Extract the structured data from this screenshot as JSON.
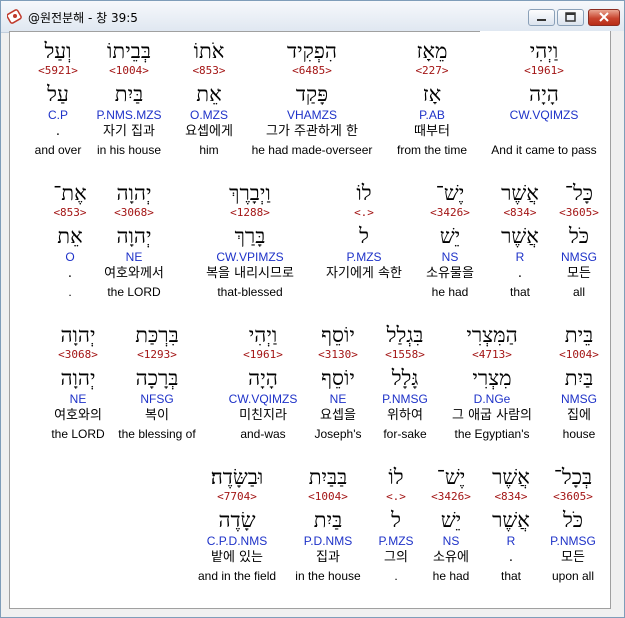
{
  "window": {
    "title": "@원전분해 - 창 39:5"
  },
  "rows": [
    [
      {
        "heb": "וַיְהִי",
        "num": "<1961>",
        "root": "הָיָה",
        "morph": "CW.VQIMZS",
        "kor": "",
        "eng": "And it came to pass"
      },
      {
        "heb": "מֵאָז",
        "num": "<227>",
        "root": "אָז",
        "morph": "P.AB",
        "kor": "때부터",
        "eng": "from the time"
      },
      {
        "heb": "הִפְקִיד",
        "num": "<6485>",
        "root": "פָּקַד",
        "morph": "VHAMZS",
        "kor": "그가 주관하게 한",
        "eng": "he had made-overseer"
      },
      {
        "heb": "אֹתוֹ",
        "num": "<853>",
        "root": "אֵת",
        "morph": "O.MZS",
        "kor": "요셉에게",
        "eng": "him"
      },
      {
        "heb": "בְּבֵיתוֹ",
        "num": "<1004>",
        "root": "בַּיִת",
        "morph": "P.NMS.MZS",
        "kor": "자기 집과",
        "eng": "in his house"
      },
      {
        "heb": "וְעַל",
        "num": "<5921>",
        "root": "עַל",
        "morph": "C.P",
        "kor": ".",
        "eng": "and over"
      }
    ],
    [
      {
        "heb": "כָּל־",
        "num": "<3605>",
        "root": "כֹּל",
        "morph": "NMSG",
        "kor": "모든",
        "eng": "all"
      },
      {
        "heb": "אֲשֶׁר",
        "num": "<834>",
        "root": "אֲשֶׁר",
        "morph": "R",
        "kor": ".",
        "eng": "that"
      },
      {
        "heb": "יֶשׁ־",
        "num": "<3426>",
        "root": "יֵשׁ",
        "morph": "NS",
        "kor": "소유물을",
        "eng": "he had"
      },
      {
        "heb": "לוֹ",
        "num": "<.>",
        "root": "ל",
        "morph": "P.MZS",
        "kor": "자기에게 속한",
        "eng": ""
      },
      {
        "heb": "וַיְבָרֶךְ",
        "num": "<1288>",
        "root": "בָּרַךְ",
        "morph": "CW.VPIMZS",
        "kor": "복을 내리시므로",
        "eng": "that-blessed"
      },
      {
        "heb": "יְהוָה",
        "num": "<3068>",
        "root": "יְהוָה",
        "morph": "NE",
        "kor": "여호와께서",
        "eng": "the LORD"
      },
      {
        "heb": "אֶת־",
        "num": "<853>",
        "root": "אֵת",
        "morph": "O",
        "kor": ".",
        "eng": "."
      }
    ],
    [
      {
        "heb": "בֵּית",
        "num": "<1004>",
        "root": "בַּיִת",
        "morph": "NMSG",
        "kor": "집에",
        "eng": "house"
      },
      {
        "heb": "הַמִּצְרִי",
        "num": "<4713>",
        "root": "מִצְרִי",
        "morph": "D.NGe",
        "kor": "그 애굽 사람의",
        "eng": "the Egyptian's"
      },
      {
        "heb": "בִּגְלַל",
        "num": "<1558>",
        "root": "גָּלָל",
        "morph": "P.NMSG",
        "kor": "위하여",
        "eng": "for-sake"
      },
      {
        "heb": "יוֹסֵף",
        "num": "<3130>",
        "root": "יוֹסֵף",
        "morph": "NE",
        "kor": "요셉을",
        "eng": "Joseph's"
      },
      {
        "heb": "וַיְהִי",
        "num": "<1961>",
        "root": "הָיָה",
        "morph": "CW.VQIMZS",
        "kor": "미친지라",
        "eng": "and-was"
      },
      {
        "heb": "בִּרְכַּת",
        "num": "<1293>",
        "root": "בְּרָכָה",
        "morph": "NFSG",
        "kor": "복이",
        "eng": "the blessing of"
      },
      {
        "heb": "יְהוָה",
        "num": "<3068>",
        "root": "יְהוָה",
        "morph": "NE",
        "kor": "여호와의",
        "eng": "the LORD"
      }
    ],
    [
      {
        "heb": "בְּכָל־",
        "num": "<3605>",
        "root": "כֹּל",
        "morph": "P.NMSG",
        "kor": "모든",
        "eng": "upon all"
      },
      {
        "heb": "אֲשֶׁר",
        "num": "<834>",
        "root": "אֲשֶׁר",
        "morph": "R",
        "kor": ".",
        "eng": "that"
      },
      {
        "heb": "יֶשׁ־",
        "num": "<3426>",
        "root": "יֵשׁ",
        "morph": "NS",
        "kor": "소유에",
        "eng": "he had"
      },
      {
        "heb": "לוֹ",
        "num": "<.>",
        "root": "ל",
        "morph": "P.MZS",
        "kor": "그의",
        "eng": "."
      },
      {
        "heb": "בַּבַּיִת",
        "num": "<1004>",
        "root": "בַּיִת",
        "morph": "P.D.NMS",
        "kor": "집과",
        "eng": "in the house"
      },
      {
        "heb": "וּבַשָּׂדֶה׃",
        "num": "<7704>",
        "root": "שָׂדֶה",
        "morph": "C.P.D.NMS",
        "kor": "밭에 있는",
        "eng": "and in the field"
      }
    ]
  ]
}
